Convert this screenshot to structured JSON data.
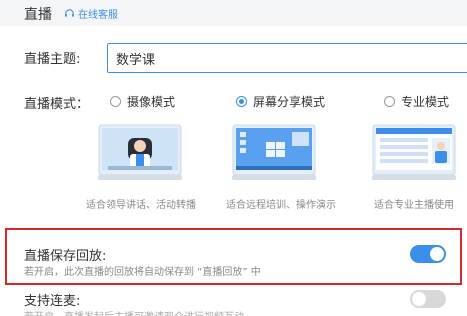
{
  "header": {
    "title": "直播",
    "support_label": "在线客服"
  },
  "topic": {
    "label": "直播主题:",
    "value": "数学课"
  },
  "mode": {
    "label": "直播模式：",
    "selected": "屏幕分享模式",
    "options": [
      {
        "label": "摄像模式",
        "caption": "适合领导讲话、活动转播",
        "icon": "camera-mode-illustration"
      },
      {
        "label": "屏幕分享模式",
        "caption": "适合远程培训、操作演示",
        "icon": "screen-share-illustration"
      },
      {
        "label": "专业模式",
        "caption": "适合专业主播使用",
        "icon": "pro-mode-illustration"
      }
    ]
  },
  "save_replay": {
    "label": "直播保存回放:",
    "description": "若开启，此次直播的回放将自动保存到 “直播回放” 中",
    "enabled": true
  },
  "co_host": {
    "label": "支持连麦:",
    "description": "若开启，直播发起后主播可邀请观众进行视频互动",
    "enabled": false
  },
  "colors": {
    "accent": "#3b8eea",
    "highlight_border": "#d9282c",
    "toggle_off": "#d8d8d8"
  }
}
